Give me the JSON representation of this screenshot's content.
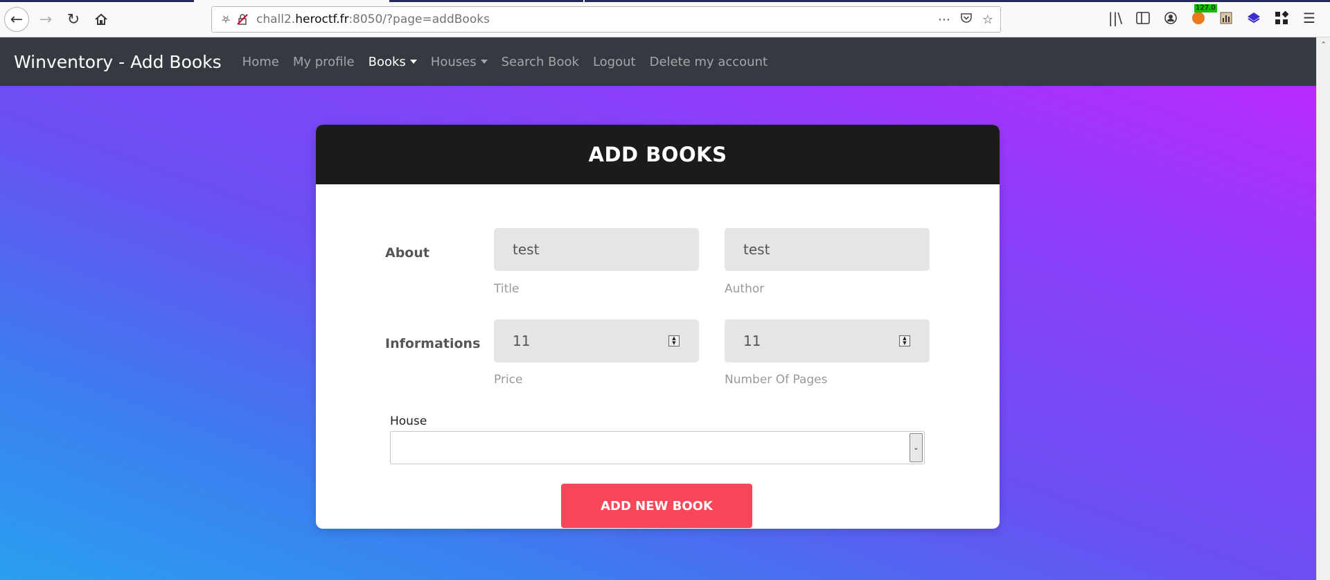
{
  "browser": {
    "url_prefix": "chall2.",
    "url_host": "heroctf.fr",
    "url_suffix": ":8050/?page=addBooks",
    "extension_badge": "127.0"
  },
  "navbar": {
    "brand": "Winventory - Add Books",
    "links": {
      "home": "Home",
      "profile": "My profile",
      "books": "Books",
      "houses": "Houses",
      "search": "Search Book",
      "logout": "Logout",
      "delete": "Delete my account"
    }
  },
  "form": {
    "header": "ADD BOOKS",
    "about_label": "About",
    "info_label": "Informations",
    "title_value": "test",
    "title_hint": "Title",
    "author_value": "test",
    "author_hint": "Author",
    "price_value": "11",
    "price_hint": "Price",
    "pages_value": "11",
    "pages_hint": "Number Of Pages",
    "house_label": "House",
    "house_value": "",
    "submit_label": "ADD NEW BOOK"
  },
  "colors": {
    "navbar_bg": "#343a40",
    "card_header_bg": "#1b1b1b",
    "submit_bg": "#fa4659"
  }
}
